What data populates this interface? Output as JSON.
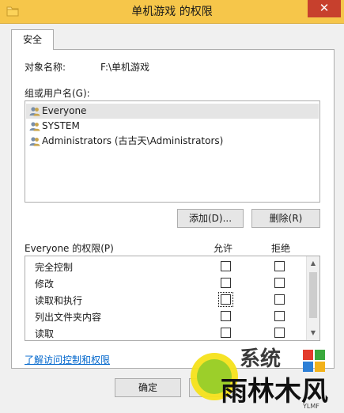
{
  "window": {
    "title": "单机游戏 的权限",
    "close_glyph": "✕"
  },
  "tabs": [
    {
      "label": "安全",
      "selected": true
    }
  ],
  "object": {
    "label": "对象名称:",
    "value": "F:\\单机游戏"
  },
  "groups": {
    "label": "组或用户名(G):",
    "items": [
      {
        "name": "Everyone",
        "selected": true
      },
      {
        "name": "SYSTEM",
        "selected": false
      },
      {
        "name": "Administrators (古古天\\Administrators)",
        "selected": false
      }
    ],
    "add_button": "添加(D)...",
    "remove_button": "删除(R)"
  },
  "permissions": {
    "label": "Everyone 的权限(P)",
    "allow_header": "允许",
    "deny_header": "拒绝",
    "rows": [
      {
        "name": "完全控制",
        "allow": false,
        "deny": false
      },
      {
        "name": "修改",
        "allow": false,
        "deny": false
      },
      {
        "name": "读取和执行",
        "allow": false,
        "deny": false
      },
      {
        "name": "列出文件夹内容",
        "allow": false,
        "deny": false
      },
      {
        "name": "读取",
        "allow": false,
        "deny": false
      }
    ]
  },
  "link_text": "了解访问控制和权限",
  "footer": {
    "ok_button": "确定"
  },
  "watermark": {
    "line1": "系统",
    "line2": "雨林木风",
    "caption": "YLMF"
  },
  "colors": {
    "titlebar": "#f6c64a",
    "close": "#c7402d",
    "link": "#0066cc"
  }
}
